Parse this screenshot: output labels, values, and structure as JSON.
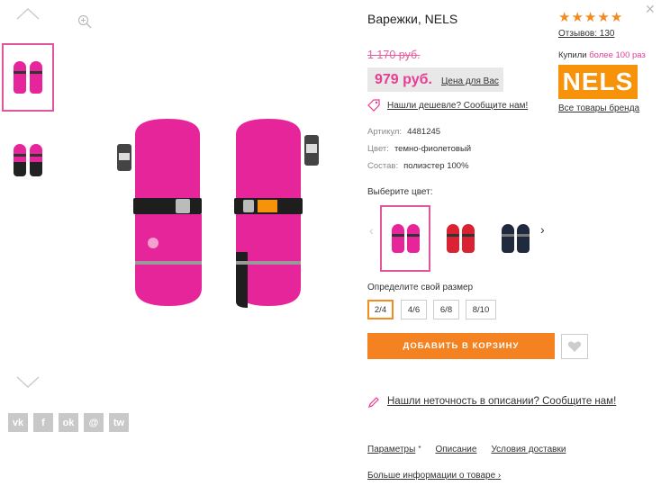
{
  "product": {
    "title": "Варежки, NELS",
    "old_price": "1 170 руб.",
    "new_price": "979 руб.",
    "price_note": "Цена для Вас",
    "cheaper_link": "Нашли дешевле? Сообщите нам!",
    "article_label": "Артикул:",
    "article_value": "4481245",
    "color_label": "Цвет:",
    "color_value": "темно-фиолетовый",
    "composition_label": "Состав:",
    "composition_value": "полиэстер 100%"
  },
  "rating": {
    "stars": 5,
    "reviews": "Отзывов: 130"
  },
  "brand": {
    "bought_prefix": "Купили",
    "bought_count": "более 100 раз",
    "logo_text": "NELS",
    "all_goods": "Все товары бренда",
    "brand_color": "#f7930a"
  },
  "colors": {
    "label": "Выберите цвет:",
    "options": [
      {
        "name": "pink",
        "hex": "#e6259a"
      },
      {
        "name": "red",
        "hex": "#d92332"
      },
      {
        "name": "navy",
        "hex": "#1f2a3f"
      }
    ]
  },
  "sizes": {
    "label": "Определите свой размер",
    "options": [
      "2/4",
      "4/6",
      "6/8",
      "8/10"
    ],
    "selected": "2/4"
  },
  "actions": {
    "add_to_cart": "ДОБАВИТЬ В КОРЗИНУ",
    "inaccuracy": "Нашли неточность в описании? Сообщите нам!"
  },
  "tabs": {
    "params": "Параметры",
    "description": "Описание",
    "delivery": "Условия доставки",
    "more_info": "Больше информации о товаре"
  },
  "social": [
    "vk",
    "f",
    "ok",
    "@",
    "tw"
  ],
  "accent": "#e83c92",
  "cta": "#f58220"
}
